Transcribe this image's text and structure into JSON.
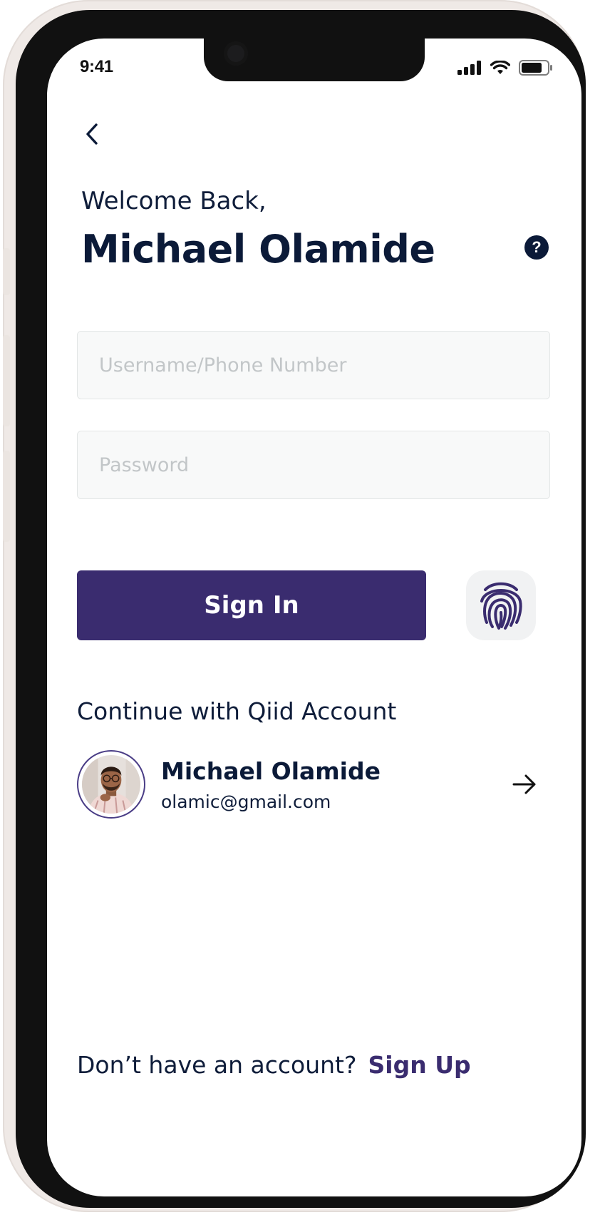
{
  "status_bar": {
    "time": "9:41",
    "icons": [
      "cellular-signal-icon",
      "wifi-icon",
      "battery-icon"
    ]
  },
  "header": {
    "back_icon": "chevron-left-icon",
    "greeting": "Welcome Back,",
    "user_name": "Michael Olamide",
    "help_icon": "question-mark-icon",
    "help_glyph": "?"
  },
  "form": {
    "username_placeholder": "Username/Phone Number",
    "username_value": "",
    "password_placeholder": "Password",
    "password_value": "",
    "sign_in_label": "Sign In",
    "biometric_icon": "fingerprint-icon"
  },
  "qiid": {
    "label": "Continue with Qiid Account",
    "account": {
      "name": "Michael Olamide",
      "email": "olamic@gmail.com",
      "avatar": "avatar-photo",
      "arrow_icon": "arrow-right-icon"
    }
  },
  "footer": {
    "prompt": "Don’t have an account?",
    "sign_up_label": "Sign Up"
  },
  "colors": {
    "primary": "#3a2c6f",
    "text_dark": "#0b1a38",
    "field_bg": "#f8f9f9",
    "field_border": "#e3e6e6",
    "placeholder": "#c2c6c8"
  }
}
